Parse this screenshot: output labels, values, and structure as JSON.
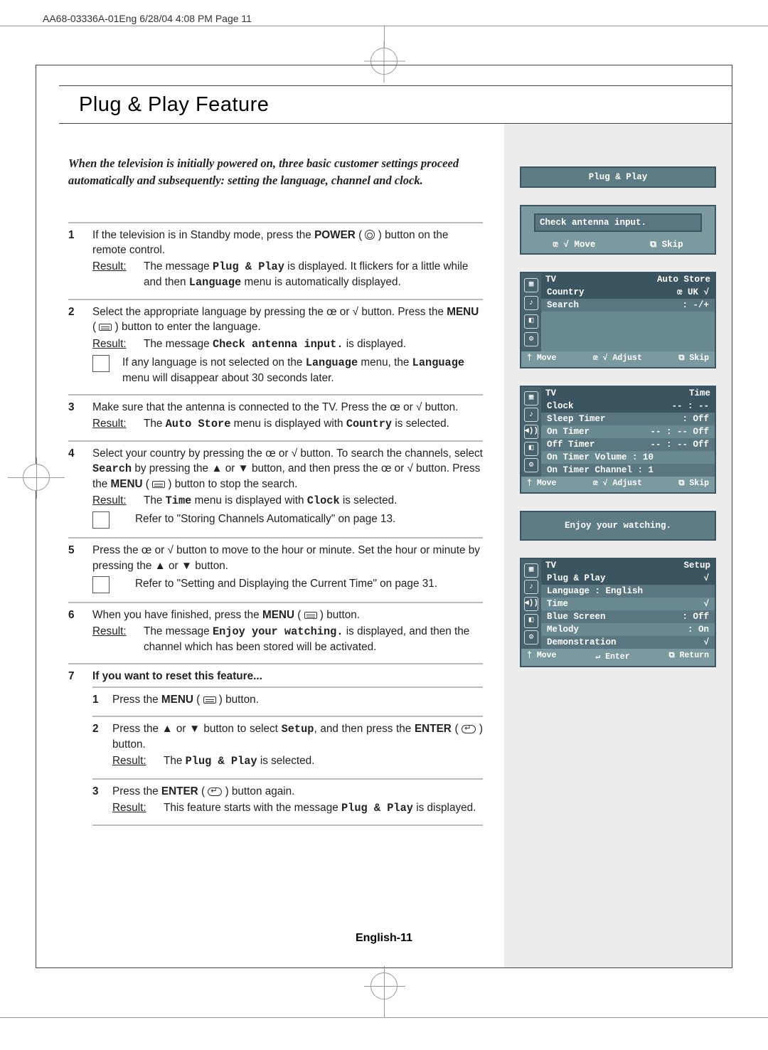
{
  "print_header": "AA68-03336A-01Eng  6/28/04  4:08 PM  Page 11",
  "title": "Plug & Play Feature",
  "intro": "When the television is initially powered on, three basic customer settings proceed automatically and subsequently: setting the language, channel and clock.",
  "labels": {
    "result": "Result:"
  },
  "steps": {
    "s1": {
      "num": "1",
      "p_a": "If the television is in Standby mode, press the ",
      "p_b": "POWER",
      "p_c": " ( ",
      "p_d": " ) button on the remote control.",
      "r_a": "The message ",
      "r_b": "Plug & Play",
      "r_c": " is displayed. It flickers for a little while and then ",
      "r_d": "Language",
      "r_e": " menu is automatically displayed."
    },
    "s2": {
      "num": "2",
      "p_a": "Select the appropriate language by pressing the ",
      "p_b": "œ",
      "p_c": " or ",
      "p_d": "√",
      "p_e": " button. Press the ",
      "p_f": "MENU",
      "p_g": " ( ",
      "p_h": " ) button to enter the language.",
      "r_a": "The message ",
      "r_b": "Check antenna input.",
      "r_c": " is displayed.",
      "n_a": "If any language is not selected on the ",
      "n_b": "Language",
      "n_c": " menu, the ",
      "n_d": "Language",
      "n_e": " menu will disappear about 30 seconds later."
    },
    "s3": {
      "num": "3",
      "p_a": "Make sure that the antenna is connected to the TV. Press the ",
      "p_b": "œ",
      "p_c": " or ",
      "p_d": "√",
      "p_e": " button.",
      "r_a": "The ",
      "r_b": "Auto Store",
      "r_c": " menu is displayed with ",
      "r_d": "Country",
      "r_e": " is selected."
    },
    "s4": {
      "num": "4",
      "p_a": "Select your country by pressing the ",
      "p_b": "œ",
      "p_c": " or ",
      "p_d": "√",
      "p_e": " button. To search the channels, select ",
      "p_f": "Search",
      "p_g": " by pressing the ▲ or ▼ button, and then press the ",
      "p_h": "œ",
      "p_i": " or ",
      "p_j": "√",
      "p_k": " button. Press the ",
      "p_l": "MENU",
      "p_m": " ( ",
      "p_n": " ) button to stop the search.",
      "r_a": "The ",
      "r_b": "Time",
      "r_c": " menu is displayed with ",
      "r_d": "Clock",
      "r_e": " is selected.",
      "ref": "Refer to \"Storing Channels Automatically\" on page 13."
    },
    "s5": {
      "num": "5",
      "p_a": "Press the ",
      "p_b": "œ",
      "p_c": " or ",
      "p_d": "√",
      "p_e": " button to move to the hour or minute. Set the hour or minute by pressing the ▲ or ▼ button.",
      "ref": "Refer to \"Setting and Displaying the Current Time\" on page 31."
    },
    "s6": {
      "num": "6",
      "p_a": "When you have finished, press the ",
      "p_b": "MENU",
      "p_c": " ( ",
      "p_d": " ) button.",
      "r_a": "The message ",
      "r_b": "Enjoy your watching.",
      "r_c": " is displayed, and then the channel which has been stored will be activated."
    },
    "s7": {
      "num": "7",
      "title": "If you want to reset this feature...",
      "sub1": {
        "num": "1",
        "a": "Press the ",
        "b": "MENU",
        "c": " ( ",
        "d": " ) button."
      },
      "sub2": {
        "num": "2",
        "a": "Press the ▲ or ▼ button to select ",
        "b": "Setup",
        "c": ", and then press the ",
        "d": "ENTER",
        "e": " ( ",
        "f": " ) button.",
        "r_a": "The ",
        "r_b": "Plug & Play",
        "r_c": " is selected."
      },
      "sub3": {
        "num": "3",
        "a": "Press the ",
        "b": "ENTER",
        "c": " ( ",
        "d": " ) button again.",
        "r_a": "This feature starts with the message ",
        "r_b": "Plug & Play",
        "r_c": " is displayed."
      }
    }
  },
  "osd": {
    "plugplay_title": "Plug & Play",
    "check_antenna": "Check antenna input.",
    "hints": {
      "move": "Move",
      "skip": "Skip",
      "adjust": "Adjust",
      "enter": "Enter",
      "return": "Return",
      "arrows_lr": "œ √",
      "arrows_ud": "†",
      "menu_icon": "⧉"
    },
    "auto_store": {
      "tv": "TV",
      "title": "Auto Store",
      "country_label": "Country",
      "country_val": "UK",
      "search_label": "Search",
      "search_val": ": -/+"
    },
    "time": {
      "tv": "TV",
      "title": "Time",
      "clock": "Clock",
      "clock_v": "-- : --",
      "sleep": "Sleep Timer",
      "sleep_v": ": Off",
      "on_t": "On Timer",
      "on_t_v": "-- : -- Off",
      "off_t": "Off Timer",
      "off_t_v": "-- : -- Off",
      "on_vol": "On Timer Volume : 10",
      "on_ch": "On Timer Channel : 1"
    },
    "enjoy": "Enjoy your watching.",
    "setup": {
      "tv": "TV",
      "title": "Setup",
      "pp": "Plug & Play",
      "lang": "Language  : English",
      "time": "Time",
      "blue": "Blue Screen",
      "blue_v": ": Off",
      "melody": "Melody",
      "melody_v": ": On",
      "demo": "Demonstration"
    }
  },
  "footer": "English-11"
}
